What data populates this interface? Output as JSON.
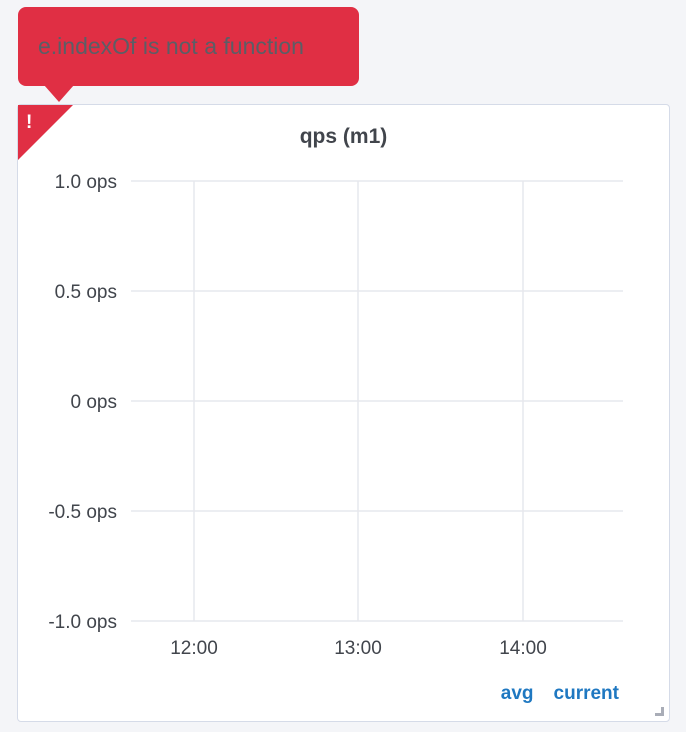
{
  "error": {
    "message": "e.indexOf is not a function",
    "indicator": "!"
  },
  "panel": {
    "title": "qps (m1)",
    "legend": {
      "avg_label": "avg",
      "current_label": "current"
    }
  },
  "colors": {
    "error": "#e02f44",
    "legend": "#1f78c1",
    "grid": "#e6e8ed"
  },
  "chart_data": {
    "type": "line",
    "title": "qps (m1)",
    "xlabel": "",
    "ylabel": "",
    "ylim": [
      -1.0,
      1.0
    ],
    "y_ticks": [
      1.0,
      0.5,
      0,
      -0.5,
      -1.0
    ],
    "y_tick_labels": [
      "1.0 ops",
      "0.5 ops",
      "0 ops",
      "-0.5 ops",
      "-1.0 ops"
    ],
    "x_ticks": [
      "12:00",
      "13:00",
      "14:00"
    ],
    "grid": true,
    "legend_placement": "bottom-right",
    "series": []
  }
}
